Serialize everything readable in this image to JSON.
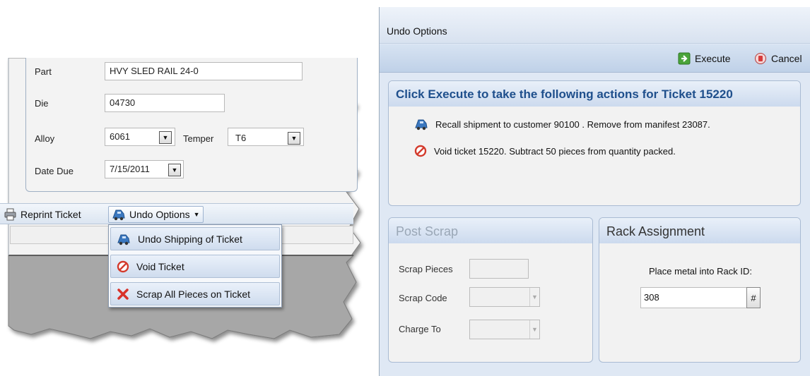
{
  "left_form": {
    "part_label": "Part",
    "part_value": "HVY SLED RAIL 24-0",
    "die_label": "Die",
    "die_value": "04730",
    "alloy_label": "Alloy",
    "alloy_value": "6061",
    "temper_label": "Temper",
    "temper_value": "T6",
    "date_due_label": "Date Due",
    "date_due_value": "7/15/2011"
  },
  "left_toolbar": {
    "reprint_label": "Reprint Ticket",
    "undo_label": "Undo Options"
  },
  "undo_menu": {
    "items": [
      {
        "label": "Undo Shipping of Ticket",
        "icon": "truck-icon"
      },
      {
        "label": "Void Ticket",
        "icon": "no-entry-icon"
      },
      {
        "label": "Scrap All Pieces on Ticket",
        "icon": "red-x-icon"
      }
    ]
  },
  "dialog": {
    "title": "Undo Options",
    "toolbar": {
      "execute_label": "Execute",
      "cancel_label": "Cancel"
    },
    "actions_panel": {
      "heading": "Click Execute to take the following actions for Ticket 15220",
      "actions": [
        {
          "text": "Recall shipment to customer 90100 . Remove from manifest 23087.",
          "icon": "truck-icon"
        },
        {
          "text": "Void ticket 15220. Subtract 50 pieces from quantity packed.",
          "icon": "no-entry-icon"
        }
      ]
    },
    "post_scrap": {
      "heading": "Post Scrap",
      "scrap_pieces_label": "Scrap Pieces",
      "scrap_code_label": "Scrap Code",
      "charge_to_label": "Charge To"
    },
    "rack_assignment": {
      "heading": "Rack Assignment",
      "prompt": "Place metal into Rack ID:",
      "rack_id_value": "308",
      "lookup_button": "#"
    }
  },
  "colors": {
    "heading_blue": "#1e4f8c",
    "panel_header": "#ccdaee",
    "dialog_bg": "#dfe8f4"
  }
}
